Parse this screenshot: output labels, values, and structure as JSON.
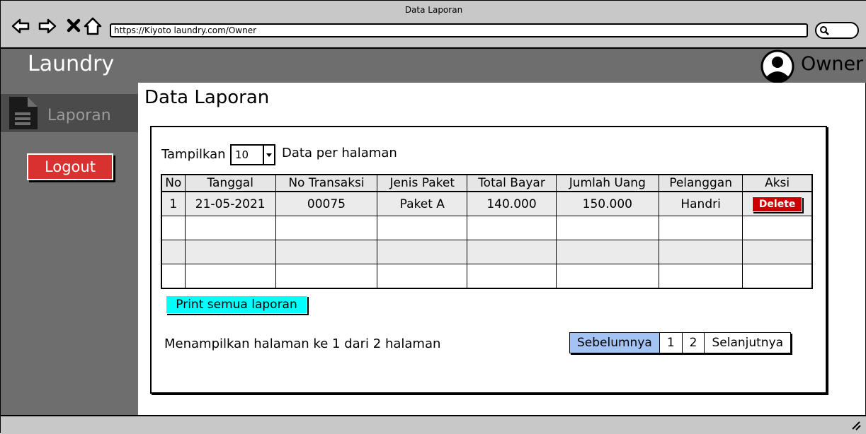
{
  "browser": {
    "window_title": "Data Laporan",
    "url": "https://Kiyoto laundry.com/Owner",
    "nav_icons": [
      "back-icon",
      "forward-icon",
      "close-icon",
      "home-icon"
    ],
    "search_icon": "search-icon"
  },
  "header": {
    "app_title": "Laundry",
    "user_label": "Owner",
    "user_icon": "user-avatar-icon"
  },
  "sidebar": {
    "items": [
      {
        "label": "Laporan",
        "icon": "document-icon"
      }
    ],
    "logout_label": "Logout"
  },
  "main": {
    "page_title": "Data Laporan",
    "show_label": "Tampilkan",
    "page_size_value": "10",
    "per_page_label": "Data per halaman",
    "table": {
      "headers": [
        "No",
        "Tanggal",
        "No Transaksi",
        "Jenis Paket",
        "Total Bayar",
        "Jumlah Uang",
        "Pelanggan",
        "Aksi"
      ],
      "rows": [
        [
          "1",
          "21-05-2021",
          "00075",
          "Paket A",
          "140.000",
          "150.000",
          "Handri",
          "Delete"
        ],
        [
          "",
          "",
          "",
          "",
          "",
          "",
          "",
          ""
        ],
        [
          "",
          "",
          "",
          "",
          "",
          "",
          "",
          ""
        ],
        [
          "",
          "",
          "",
          "",
          "",
          "",
          "",
          ""
        ]
      ]
    },
    "print_label": "Print semua laporan",
    "page_info": "Menampilkan halaman ke 1 dari 2 halaman",
    "pagination": {
      "prev_label": "Sebelumnya",
      "pages": [
        "1",
        "2"
      ],
      "next_label": "Selanjutnya"
    }
  },
  "colors": {
    "header_bg": "#6e6e6e",
    "sidebar_active_bg": "#4b4b4b",
    "logout_bg": "#d9312f",
    "delete_bg": "#cc0000",
    "print_bg": "#00ffff",
    "pager_active_bg": "#a4c3f5"
  }
}
